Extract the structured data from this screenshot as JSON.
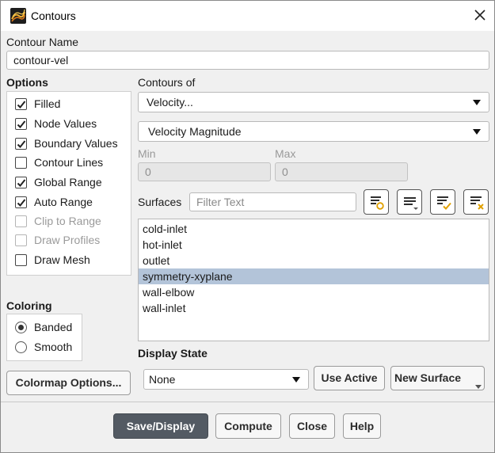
{
  "window": {
    "title": "Contours",
    "close_icon": "close-icon",
    "app_icon": "contours-app-icon"
  },
  "contour_name": {
    "label": "Contour Name",
    "value": "contour-vel"
  },
  "options": {
    "heading": "Options",
    "items": [
      {
        "label": "Filled",
        "checked": true,
        "enabled": true
      },
      {
        "label": "Node Values",
        "checked": true,
        "enabled": true
      },
      {
        "label": "Boundary Values",
        "checked": true,
        "enabled": true
      },
      {
        "label": "Contour Lines",
        "checked": false,
        "enabled": true
      },
      {
        "label": "Global Range",
        "checked": true,
        "enabled": true
      },
      {
        "label": "Auto Range",
        "checked": true,
        "enabled": true
      },
      {
        "label": "Clip to Range",
        "checked": false,
        "enabled": false
      },
      {
        "label": "Draw Profiles",
        "checked": false,
        "enabled": false
      },
      {
        "label": "Draw Mesh",
        "checked": false,
        "enabled": true
      }
    ]
  },
  "coloring": {
    "heading": "Coloring",
    "options": [
      {
        "label": "Banded",
        "selected": true
      },
      {
        "label": "Smooth",
        "selected": false
      }
    ]
  },
  "colormap_button": "Colormap Options...",
  "contours_of": {
    "label": "Contours of",
    "category": "Velocity...",
    "quantity": "Velocity Magnitude"
  },
  "range": {
    "min_label": "Min",
    "min_value": "0",
    "max_label": "Max",
    "max_value": "0"
  },
  "surfaces": {
    "label": "Surfaces",
    "filter_placeholder": "Filter Text",
    "tool_icons": [
      "new-surface-filter-icon",
      "select-menu-icon",
      "select-all-icon",
      "deselect-all-icon"
    ],
    "items": [
      {
        "name": "cold-inlet",
        "selected": false
      },
      {
        "name": "hot-inlet",
        "selected": false
      },
      {
        "name": "outlet",
        "selected": false
      },
      {
        "name": "symmetry-xyplane",
        "selected": true
      },
      {
        "name": "wall-elbow",
        "selected": false
      },
      {
        "name": "wall-inlet",
        "selected": false
      }
    ]
  },
  "display_state": {
    "label": "Display State",
    "value": "None",
    "use_active": "Use Active",
    "new_surface": "New Surface"
  },
  "footer": {
    "save_display": "Save/Display",
    "compute": "Compute",
    "close": "Close",
    "help": "Help"
  },
  "colors": {
    "selection": "#b3c4d9",
    "primary_button": "#535a63",
    "dialog_background": "#f0f0f0",
    "icon_accent": "#e0a000"
  }
}
